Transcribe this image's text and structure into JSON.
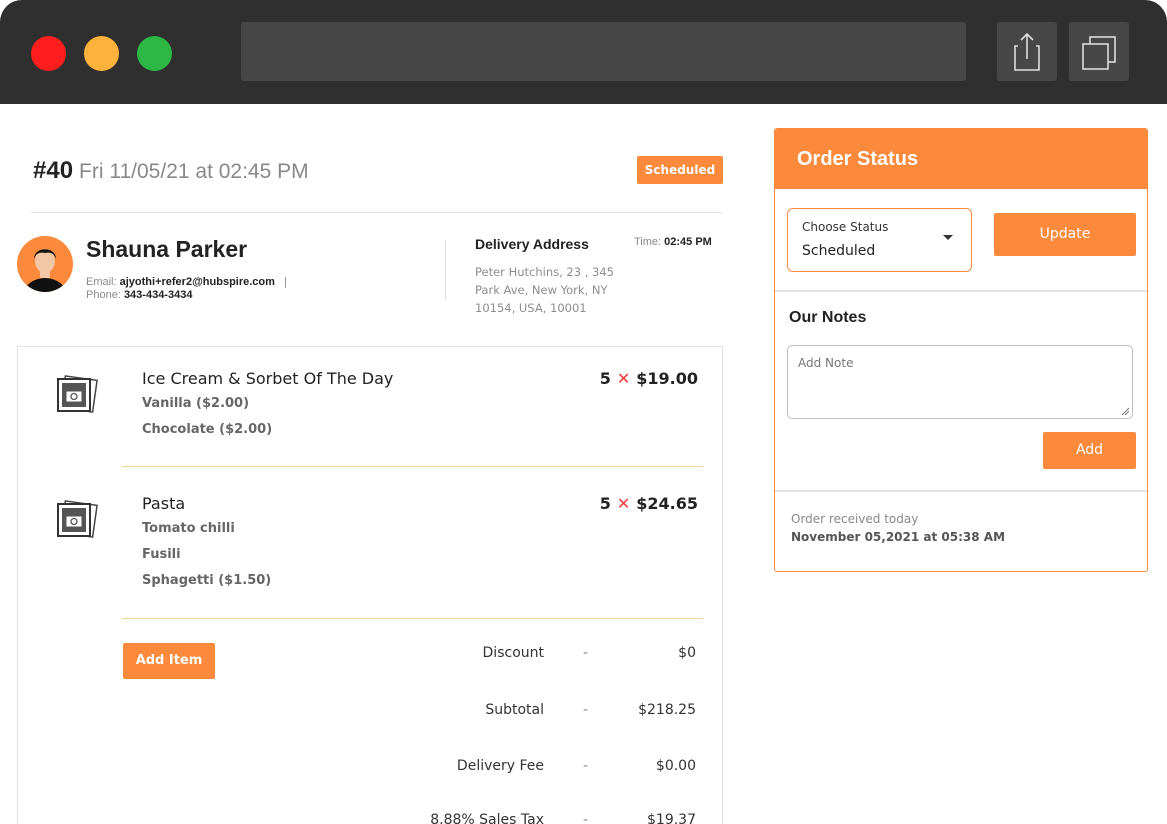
{
  "window": {
    "icons": {
      "share": "share-icon",
      "tabs": "tabs-icon"
    }
  },
  "order": {
    "number": "#40",
    "datetime": "Fri 11/05/21 at 02:45 PM",
    "status_badge": "Scheduled"
  },
  "customer": {
    "name": "Shauna Parker",
    "email_label": "Email:",
    "email": "ajyothi+refer2@hubspire.com",
    "separator": "|",
    "phone_label": "Phone:",
    "phone": "343-434-3434"
  },
  "delivery": {
    "title": "Delivery Address",
    "address": "Peter Hutchins, 23 , 345 Park Ave, New York, NY 10154, USA, 10001",
    "time_label": "Time:",
    "time": "02:45 PM"
  },
  "items": [
    {
      "name": "Ice Cream & Sorbet Of The Day",
      "quantity": "5",
      "times": "✕",
      "price": "$19.00",
      "modifiers": [
        "Vanilla ($2.00)",
        "Chocolate ($2.00)"
      ]
    },
    {
      "name": "Pasta",
      "quantity": "5",
      "times": "✕",
      "price": "$24.65",
      "modifiers": [
        "Tomato chilli",
        "Fusili",
        "Sphagetti ($1.50)"
      ]
    }
  ],
  "add_item_label": "Add Item",
  "totals": [
    {
      "label": "Discount",
      "dash": "-",
      "value": "$0"
    },
    {
      "label": "Subtotal",
      "dash": "-",
      "value": "$218.25"
    },
    {
      "label": "Delivery Fee",
      "dash": "-",
      "value": "$0.00"
    },
    {
      "label": "8.88% Sales Tax",
      "dash": "-",
      "value": "$19.37"
    }
  ],
  "status_panel": {
    "title": "Order Status",
    "select_label": "Choose Status",
    "select_value": "Scheduled",
    "update_label": "Update",
    "notes_title": "Our Notes",
    "note_placeholder": "Add Note",
    "add_label": "Add",
    "received_text": "Order received today",
    "received_date": "November 05,2021 at 05:38 AM"
  },
  "colors": {
    "accent": "#fc8a3c",
    "divider": "#f7d694",
    "chrome": "#2f2f2f",
    "close": "#fe1e1e",
    "minimize": "#fdb23b",
    "maximize": "#2db846"
  }
}
